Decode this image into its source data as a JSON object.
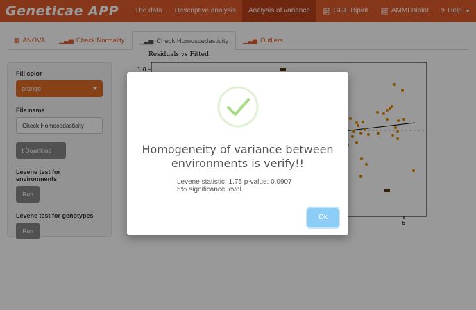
{
  "navbar": {
    "brand": "Geneticae APP",
    "items": [
      {
        "label": "The data",
        "icon": "",
        "active": false
      },
      {
        "label": "Descriptive analysis",
        "icon": "",
        "active": false
      },
      {
        "label": "Analysis of variance",
        "icon": "",
        "active": true
      },
      {
        "label": "GGE Biplot",
        "icon": "chart-icon",
        "active": false
      },
      {
        "label": "AMMI Biplot",
        "icon": "chart-icon",
        "active": false
      },
      {
        "label": "Help",
        "icon": "help-icon",
        "active": false
      }
    ]
  },
  "tabs": [
    {
      "label": "ANOVA",
      "icon": "table-icon"
    },
    {
      "label": "Check Normality",
      "icon": "chart-icon"
    },
    {
      "label": "Check Homoscedasticity",
      "icon": "chart-icon"
    },
    {
      "label": "Outliers",
      "icon": "chart-icon"
    }
  ],
  "sidebar": {
    "fill_color_label": "Fill color",
    "fill_color_value": "orange",
    "file_name_label": "File name",
    "file_name_value": "Check Homocedasticity",
    "download_label": "Download",
    "levene_env_label": "Levene test for environments",
    "levene_env_run": "Run",
    "levene_gen_label": "Levene test for genotypes",
    "levene_gen_run": "Run"
  },
  "plot": {
    "title": "Residuals vs Fitted",
    "y_tick_top": "1.0",
    "x_tick": "6",
    "point_color": "#e08a00",
    "chart_data": {
      "type": "scatter",
      "title": "Residuals vs Fitted",
      "yticks": [
        "1.0"
      ],
      "xticks": [
        "6"
      ]
    }
  },
  "modal": {
    "title_line1": "Homogeneity of variance between",
    "title_line2": "environments is verify!!",
    "text_line1": "Levene statistic: 1.75 p-value: 0.0907",
    "text_line2": "5% significance level",
    "ok_label": "Ok",
    "icon": "check-circle-icon"
  },
  "colors": {
    "navbar": "#e05a2a",
    "navbar_active": "#b9421c",
    "accent": "#e05a2a",
    "ok_button": "#8ccdf6",
    "success": "#a5dc86"
  }
}
